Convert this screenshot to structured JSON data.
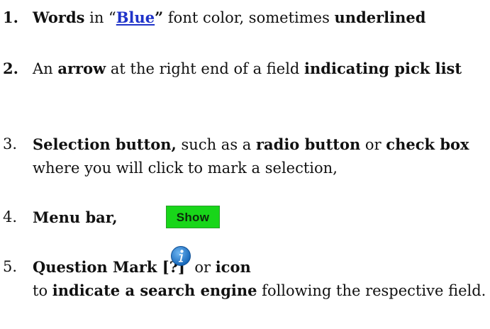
{
  "items": [
    {
      "number": "1.",
      "parts": [
        "Words",
        " in “",
        "Blue",
        "”",
        " font color, sometimes ",
        "underlined"
      ]
    },
    {
      "number": "2.",
      "parts": [
        "An ",
        "arrow",
        " at the right end of a field ",
        "indicating pick list"
      ]
    },
    {
      "number": "3.",
      "parts": [
        "Selection button,",
        " such as a ",
        "radio button",
        " or ",
        "check box",
        " where you will click to mark a selection,"
      ]
    },
    {
      "number": "4.",
      "parts": [
        "Menu bar,"
      ],
      "button_label": "Show"
    },
    {
      "number": "5.",
      "parts": [
        "Question Mark [?]",
        "  or ",
        "icon",
        "to ",
        "indicate a search engine",
        " following the respective field."
      ],
      "icon": "info-icon"
    }
  ],
  "colors": {
    "link_blue": "#1f33c9",
    "button_green": "#18d619",
    "info_icon_blue": "#1e7fd0"
  }
}
